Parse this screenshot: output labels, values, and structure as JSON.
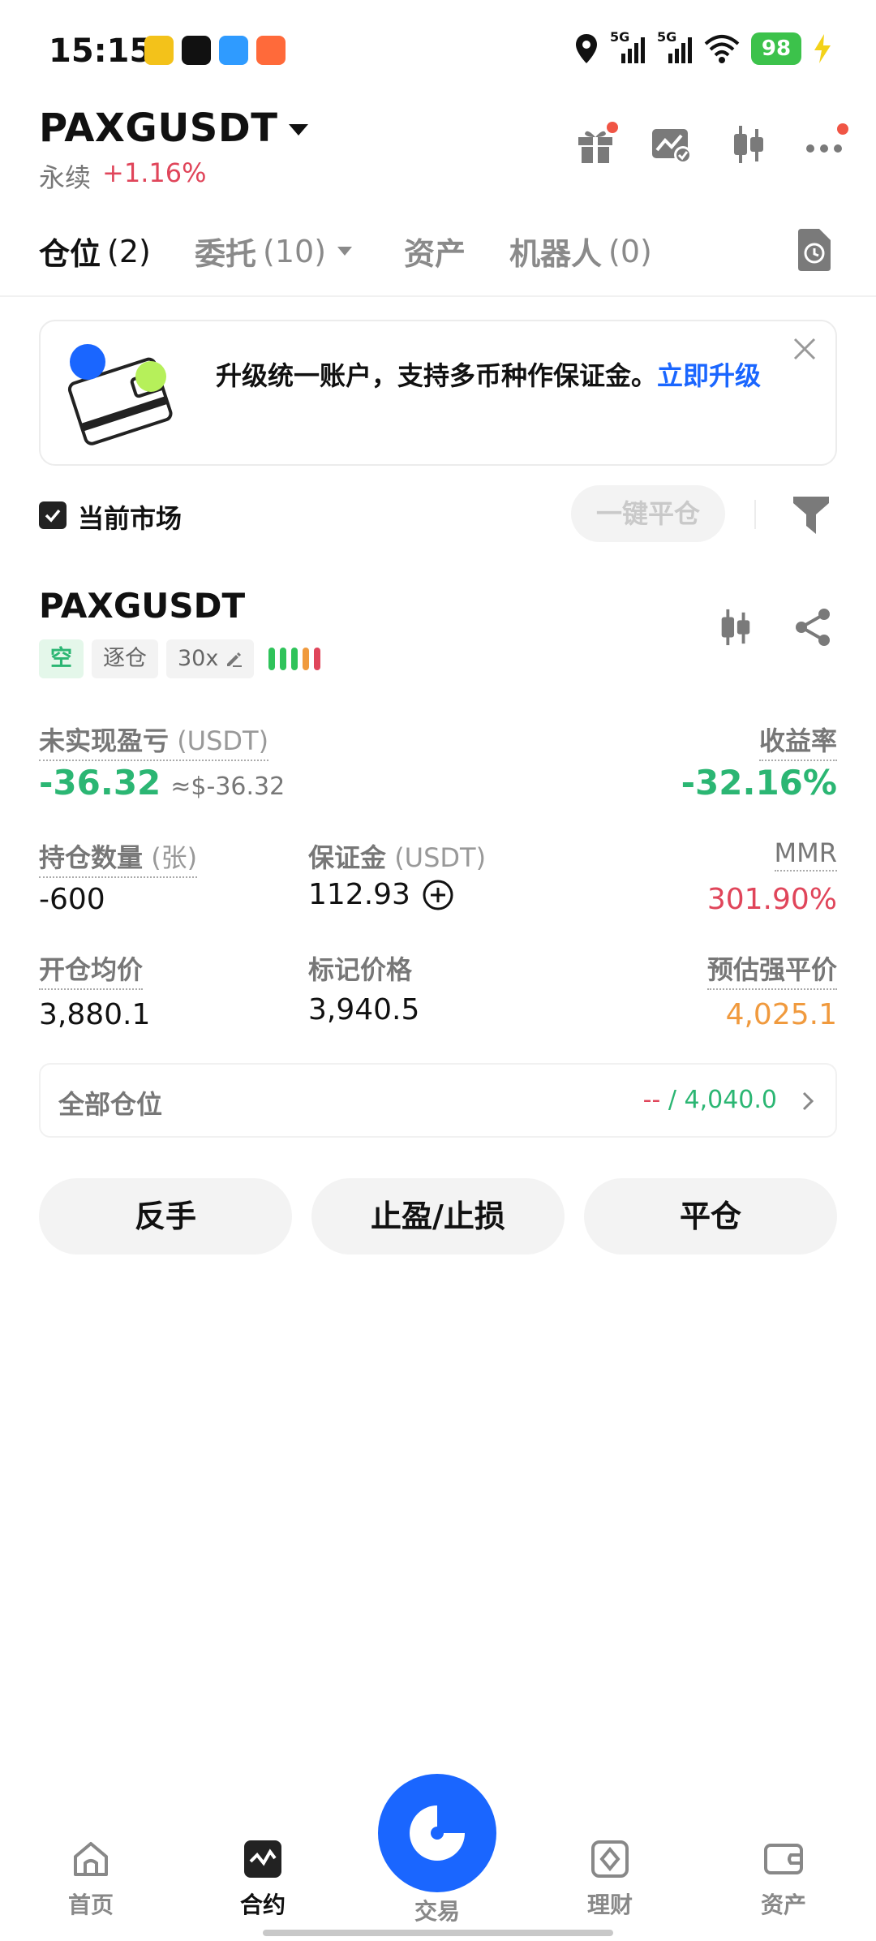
{
  "status_bar": {
    "time": "15:15",
    "network_1": "5G",
    "network_2": "5G",
    "battery": "98"
  },
  "header": {
    "symbol": "PAXGUSDT",
    "contract_type": "永续",
    "change": "+1.16%"
  },
  "tabs": [
    {
      "label": "仓位",
      "count": "(2)"
    },
    {
      "label": "委托",
      "count": "(10)"
    },
    {
      "label": "资产",
      "count": ""
    },
    {
      "label": "机器人",
      "count": "(0)"
    }
  ],
  "banner": {
    "text": "升级统一账户，支持多币种作保证金。",
    "link": "立即升级"
  },
  "filter": {
    "current_market_label": "当前市场",
    "close_all_label": "一键平仓"
  },
  "position": {
    "symbol": "PAXGUSDT",
    "side_tag": "空",
    "margin_mode_tag": "逐仓",
    "leverage_tag": "30x",
    "unrealized_pnl_label": "未实现盈亏",
    "unrealized_pnl_unit": "(USDT)",
    "unrealized_pnl": "-36.32",
    "unrealized_pnl_usd": "≈$-36.32",
    "roi_label": "收益率",
    "roi": "-32.16%",
    "size_label": "持仓数量",
    "size_unit": "(张)",
    "size": "-600",
    "margin_label": "保证金",
    "margin_unit": "(USDT)",
    "margin": "112.93",
    "mmr_label": "MMR",
    "mmr": "301.90%",
    "entry_price_label": "开仓均价",
    "entry_price": "3,880.1",
    "mark_price_label": "标记价格",
    "mark_price": "3,940.5",
    "liq_price_label": "预估强平价",
    "liq_price": "4,025.1",
    "all_positions_label": "全部仓位",
    "all_positions_left": "--",
    "all_positions_sep": " / ",
    "all_positions_right": "4,040.0"
  },
  "actions": {
    "reverse": "反手",
    "tp_sl": "止盈/止损",
    "close": "平仓"
  },
  "bottom_nav": {
    "home": "首页",
    "futures": "合约",
    "trade": "交易",
    "earn": "理财",
    "assets": "资产"
  },
  "colors": {
    "accent": "#1a66ff",
    "green": "#2bb673",
    "red": "#e0455a",
    "orange": "#f09a3e"
  }
}
